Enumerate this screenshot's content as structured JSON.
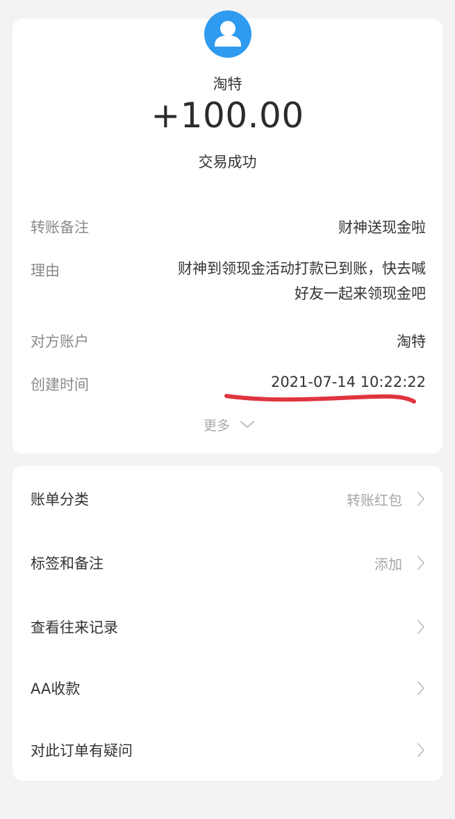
{
  "payer": {
    "name": "淘特"
  },
  "transaction": {
    "amount": "+100.00",
    "status": "交易成功"
  },
  "details": {
    "remark": {
      "label": "转账备注",
      "value": "财神送现金啦"
    },
    "reason": {
      "label": "理由",
      "value_line1": "财神到领现金活动打款已到账，快去喊",
      "value_line2": "好友一起来领现金吧"
    },
    "account": {
      "label": "对方账户",
      "value": "淘特"
    },
    "created": {
      "label": "创建时间",
      "value": "2021-07-14 10:22:22"
    },
    "more_label": "更多"
  },
  "actions": [
    {
      "label": "账单分类",
      "value": "转账红包"
    },
    {
      "label": "标签和备注",
      "value": "添加"
    },
    {
      "label": "查看往来记录",
      "value": ""
    },
    {
      "label": "AA收款",
      "value": ""
    },
    {
      "label": "对此订单有疑问",
      "value": ""
    }
  ],
  "colors": {
    "avatar": "#2f9bf0",
    "underline_annotation": "#e0353f",
    "background": "#f3f3f3"
  },
  "icons": {
    "avatar": "user-avatar-icon",
    "more": "chevron-down-icon",
    "row": "chevron-right-icon"
  }
}
